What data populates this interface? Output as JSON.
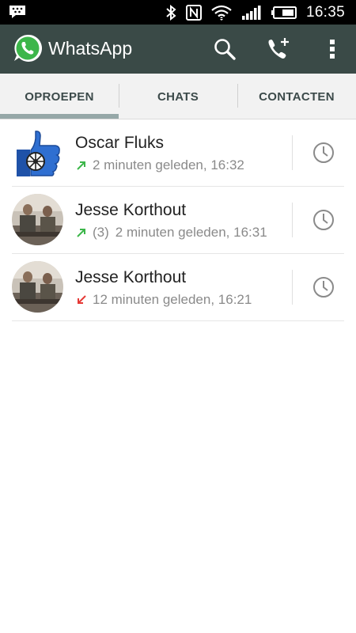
{
  "status_bar": {
    "time": "16:35",
    "icons": [
      "blackberry-messenger-icon",
      "bluetooth-icon",
      "nfc-icon",
      "wifi-icon",
      "signal-icon",
      "battery-icon"
    ]
  },
  "app_bar": {
    "title": "WhatsApp",
    "actions": [
      "search-icon",
      "new-call-icon",
      "overflow-menu-icon"
    ],
    "color": "#3a4a47"
  },
  "tabs": [
    {
      "label": "OPROEPEN",
      "active": true
    },
    {
      "label": "CHATS",
      "active": false
    },
    {
      "label": "CONTACTEN",
      "active": false
    }
  ],
  "calls": [
    {
      "name": "Oscar Fluks",
      "direction": "outgoing",
      "count": "",
      "time": "2 minuten geleden, 16:32",
      "avatar": "thumbs-up-avatar"
    },
    {
      "name": "Jesse Korthout",
      "direction": "outgoing",
      "count": "(3)",
      "time": "2 minuten geleden, 16:31",
      "avatar": "photo-avatar"
    },
    {
      "name": "Jesse Korthout",
      "direction": "missed",
      "count": "",
      "time": "12 minuten geleden, 16:21",
      "avatar": "photo-avatar"
    }
  ],
  "colors": {
    "outgoing_arrow": "#3cb64a",
    "missed_arrow": "#e53935",
    "tab_indicator": "#96a8a8"
  }
}
